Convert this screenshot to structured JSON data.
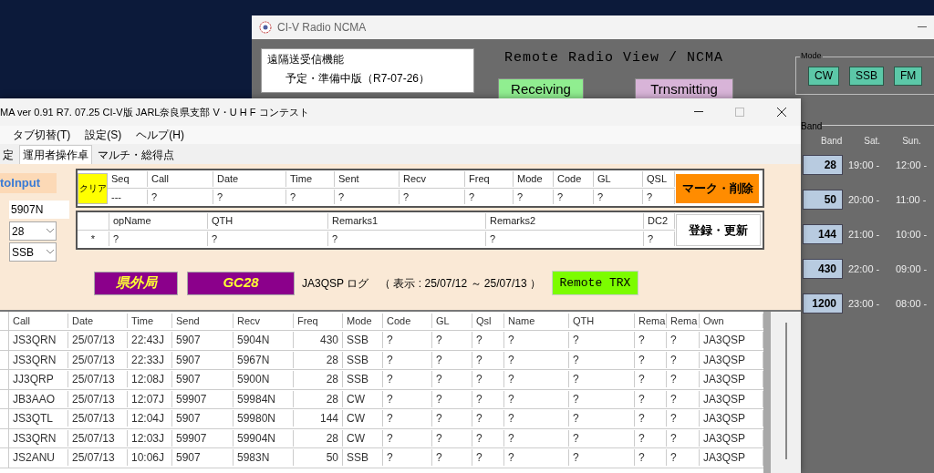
{
  "back_window": {
    "title": "CI-V Radio NCMA",
    "info_lines": [
      "遠隔送受信機能",
      "予定・準備中版（R7-07-26）"
    ],
    "heading": "Remote Radio View / NCMA",
    "status_buttons": [
      {
        "label": "Receiving",
        "kind": "receive"
      },
      {
        "label": "Trnsmitting",
        "kind": "transmit"
      }
    ],
    "mode_group": {
      "title": "Mode",
      "buttons": [
        "CW",
        "SSB",
        "FM"
      ]
    },
    "band_group": {
      "title": "Band",
      "columns": [
        "Band",
        "Sat.",
        "Sun."
      ],
      "rows": [
        {
          "band": "28",
          "sat": "19:00 -",
          "sun": "12:00 -"
        },
        {
          "band": "50",
          "sat": "20:00 -",
          "sun": "11:00 -"
        },
        {
          "band": "144",
          "sat": "21:00 -",
          "sun": "10:00 -"
        },
        {
          "band": "430",
          "sat": "22:00 -",
          "sun": "09:00 -"
        },
        {
          "band": "1200",
          "sat": "23:00 -",
          "sun": "08:00 -"
        }
      ]
    }
  },
  "front_window": {
    "title": "MA ver 0.91  R7. 07.25 CI-V版 JARL奈良県支部 V・U H F コンテスト",
    "menu": [
      "タブ切替(T)",
      "設定(S)",
      "ヘルプ(H)"
    ],
    "tabs": [
      {
        "label": "定",
        "selected": false
      },
      {
        "label": "運用者操作卓",
        "selected": true
      },
      {
        "label": "マルチ・総得点",
        "selected": false
      }
    ],
    "auto_input": "toInput",
    "fields": {
      "report": "5907N",
      "band": "28",
      "mode": "SSB"
    },
    "entry_grid": {
      "clear_button": "クリア",
      "columns": [
        "Seq",
        "Call",
        "Date",
        "Time",
        "Sent",
        "Recv",
        "Freq",
        "Mode",
        "Code",
        "GL",
        "QSL"
      ],
      "values": [
        "---",
        "?",
        "?",
        "?",
        "?",
        "?",
        "?",
        "?",
        "?",
        "?",
        "?"
      ],
      "action": "マーク・削除"
    },
    "detail_grid": {
      "columns": [
        "opName",
        "QTH",
        "Remarks1",
        "Remarks2",
        "DC2"
      ],
      "row_marker": "*",
      "values": [
        "?",
        "?",
        "?",
        "?",
        "?"
      ],
      "action": "登録・更新"
    },
    "badges": [
      "県外局",
      "GC28"
    ],
    "log_caption": "JA3QSP ログ　（ 表示 : 25/07/12 ～ 25/07/13 ）",
    "remote_button": "Remote TRX",
    "log_table": {
      "columns": [
        "Call",
        "Date",
        "Time",
        "Send",
        "Recv",
        "Freq",
        "Mode",
        "Code",
        "GL",
        "Qsl",
        "Name",
        "QTH",
        "Rema",
        "Rema",
        "Own"
      ],
      "rows": [
        [
          "JS3QRN",
          "25/07/13",
          "22:43J",
          "5907",
          "5904N",
          "430",
          "SSB",
          "?",
          "?",
          "?",
          "?",
          "?",
          "?",
          "?",
          "JA3QSP"
        ],
        [
          "JS3QRN",
          "25/07/13",
          "22:33J",
          "5907",
          "5967N",
          "28",
          "SSB",
          "?",
          "?",
          "?",
          "?",
          "?",
          "?",
          "?",
          "JA3QSP"
        ],
        [
          "JJ3QRP",
          "25/07/13",
          "12:08J",
          "5907",
          "5900N",
          "28",
          "SSB",
          "?",
          "?",
          "?",
          "?",
          "?",
          "?",
          "?",
          "JA3QSP"
        ],
        [
          "JB3AAO",
          "25/07/13",
          "12:07J",
          "59907",
          "59984N",
          "28",
          "CW",
          "?",
          "?",
          "?",
          "?",
          "?",
          "?",
          "?",
          "JA3QSP"
        ],
        [
          "JS3QTL",
          "25/07/13",
          "12:04J",
          "5907",
          "59980N",
          "144",
          "CW",
          "?",
          "?",
          "?",
          "?",
          "?",
          "?",
          "?",
          "JA3QSP"
        ],
        [
          "JS3QRN",
          "25/07/13",
          "12:03J",
          "59907",
          "59904N",
          "28",
          "CW",
          "?",
          "?",
          "?",
          "?",
          "?",
          "?",
          "?",
          "JA3QSP"
        ],
        [
          "JS2ANU",
          "25/07/13",
          "10:06J",
          "5907",
          "5983N",
          "50",
          "SSB",
          "?",
          "?",
          "?",
          "?",
          "?",
          "?",
          "?",
          "JA3QSP"
        ]
      ]
    }
  }
}
